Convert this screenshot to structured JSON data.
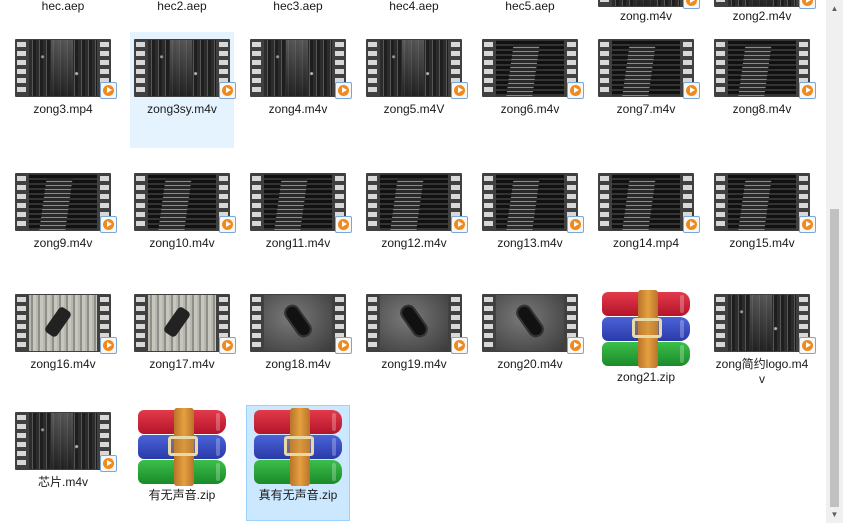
{
  "files": [
    {
      "name": "hec.aep",
      "kind": "aep"
    },
    {
      "name": "hec2.aep",
      "kind": "aep"
    },
    {
      "name": "hec3.aep",
      "kind": "aep"
    },
    {
      "name": "hec4.aep",
      "kind": "aep"
    },
    {
      "name": "hec5.aep",
      "kind": "aep"
    },
    {
      "name": "zong.m4v",
      "kind": "video-partial"
    },
    {
      "name": "zong2.m4v",
      "kind": "video-partial"
    },
    {
      "name": "zong3.mp4",
      "kind": "video",
      "thumb": "city"
    },
    {
      "name": "zong3sy.m4v",
      "kind": "video",
      "thumb": "city",
      "state": "hover"
    },
    {
      "name": "zong4.m4v",
      "kind": "video",
      "thumb": "city"
    },
    {
      "name": "zong5.m4V",
      "kind": "video",
      "thumb": "city"
    },
    {
      "name": "zong6.m4v",
      "kind": "video",
      "thumb": "tower"
    },
    {
      "name": "zong7.m4v",
      "kind": "video",
      "thumb": "tower"
    },
    {
      "name": "zong8.m4v",
      "kind": "video",
      "thumb": "tower"
    },
    {
      "name": "zong9.m4v",
      "kind": "video",
      "thumb": "tower"
    },
    {
      "name": "zong10.m4v",
      "kind": "video",
      "thumb": "tower"
    },
    {
      "name": "zong11.m4v",
      "kind": "video",
      "thumb": "tower"
    },
    {
      "name": "zong12.m4v",
      "kind": "video",
      "thumb": "tower"
    },
    {
      "name": "zong13.m4v",
      "kind": "video",
      "thumb": "tower"
    },
    {
      "name": "zong14.mp4",
      "kind": "video",
      "thumb": "tower"
    },
    {
      "name": "zong15.m4v",
      "kind": "video",
      "thumb": "tower"
    },
    {
      "name": "zong16.m4v",
      "kind": "video",
      "thumb": "lockwood"
    },
    {
      "name": "zong17.m4v",
      "kind": "video",
      "thumb": "lockwood"
    },
    {
      "name": "zong18.m4v",
      "kind": "video",
      "thumb": "lockgray"
    },
    {
      "name": "zong19.m4v",
      "kind": "video",
      "thumb": "lockgray"
    },
    {
      "name": "zong20.m4v",
      "kind": "video",
      "thumb": "lockgray"
    },
    {
      "name": "zong21.zip",
      "kind": "zip"
    },
    {
      "name": "zong简约logo.m4v",
      "kind": "video",
      "thumb": "city"
    },
    {
      "name": "芯片.m4v",
      "kind": "video",
      "thumb": "city"
    },
    {
      "name": "有无声音.zip",
      "kind": "zip"
    },
    {
      "name": "真有无声音.zip",
      "kind": "zip",
      "state": "selected"
    }
  ],
  "scrollbar": {
    "up_glyph": "▲",
    "down_glyph": "▼"
  },
  "colors": {
    "hover_bg": "#e5f3ff",
    "selected_bg": "#cce8ff",
    "selected_border": "#99d1ff",
    "play_badge": "#f08a1c"
  }
}
